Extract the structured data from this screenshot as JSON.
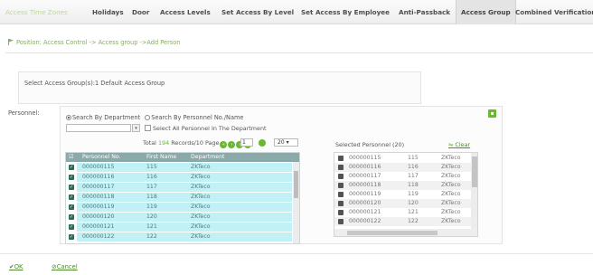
{
  "tabs": [
    {
      "label": "Access Time Zones",
      "state": "faded"
    },
    {
      "label": "Holidays",
      "state": "normal"
    },
    {
      "label": "Door",
      "state": "normal"
    },
    {
      "label": "Access Levels",
      "state": "normal"
    },
    {
      "label": "Set Access By Level",
      "state": "normal"
    },
    {
      "label": "Set Access By Employee",
      "state": "normal"
    },
    {
      "label": "Anti-Passback",
      "state": "normal"
    },
    {
      "label": "Access Group",
      "state": "active"
    },
    {
      "label": "Combined Verification",
      "state": "normal"
    }
  ],
  "breadcrumb": "Position: Access Control -> Access group ->Add Person",
  "group_selection": "Select Access Group(s):1 Default Access Group",
  "personnel": {
    "label": "Personnel:",
    "radio_department": "Search By Department",
    "radio_personnel": "Search By Personnel No./Name",
    "select_all": "Select All Personnel In The Department",
    "pager": {
      "prefix": "Total",
      "total": "194",
      "mid": "Records/10 Page",
      "page": "1",
      "page_size": "20"
    },
    "columns": [
      "Personnel No.",
      "First Name",
      "Department"
    ],
    "rows": [
      {
        "no": "000000115",
        "name": "115",
        "dept": "ZKTeco"
      },
      {
        "no": "000000116",
        "name": "116",
        "dept": "ZKTeco"
      },
      {
        "no": "000000117",
        "name": "117",
        "dept": "ZKTeco"
      },
      {
        "no": "000000118",
        "name": "118",
        "dept": "ZKTeco"
      },
      {
        "no": "000000119",
        "name": "119",
        "dept": "ZKTeco"
      },
      {
        "no": "000000120",
        "name": "120",
        "dept": "ZKTeco"
      },
      {
        "no": "000000121",
        "name": "121",
        "dept": "ZKTeco"
      },
      {
        "no": "000000122",
        "name": "122",
        "dept": "ZKTeco"
      }
    ]
  },
  "selected": {
    "title": "Selected Personnel (20)",
    "clear": "Clear",
    "rows": [
      {
        "no": "000000115",
        "name": "115",
        "dept": "ZKTeco"
      },
      {
        "no": "000000116",
        "name": "116",
        "dept": "ZKTeco"
      },
      {
        "no": "000000117",
        "name": "117",
        "dept": "ZKTeco"
      },
      {
        "no": "000000118",
        "name": "118",
        "dept": "ZKTeco"
      },
      {
        "no": "000000119",
        "name": "119",
        "dept": "ZKTeco"
      },
      {
        "no": "000000120",
        "name": "120",
        "dept": "ZKTeco"
      },
      {
        "no": "000000121",
        "name": "121",
        "dept": "ZKTeco"
      },
      {
        "no": "000000122",
        "name": "122",
        "dept": "ZKTeco"
      }
    ]
  },
  "footer": {
    "ok": "OK",
    "cancel": "Cancel"
  },
  "colors": {
    "accent_green": "#6ab830",
    "link_green": "#4f8a2f",
    "table_header": "#8ba9a9",
    "row_highlight": "#c1f1f4"
  }
}
